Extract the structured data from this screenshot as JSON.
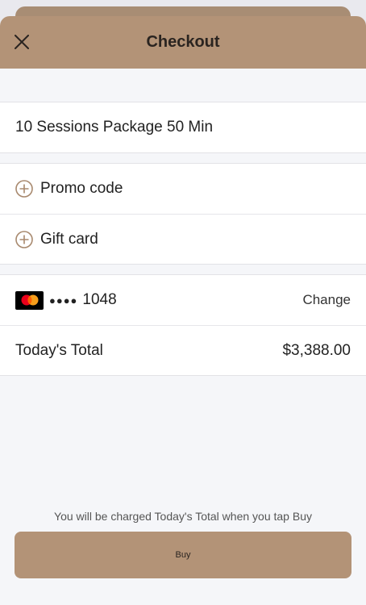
{
  "header": {
    "title": "Checkout",
    "close_icon": "close-icon"
  },
  "product": {
    "name": "10 Sessions Package 50 Min"
  },
  "discounts": {
    "promo_label": "Promo code",
    "gift_label": "Gift card",
    "icon": "plus-circle-icon"
  },
  "payment": {
    "card_brand_icon": "mastercard-icon",
    "masked_dots": "●●●●",
    "last4": "1048",
    "change_label": "Change"
  },
  "total": {
    "label": "Today's Total",
    "amount": "$3,388.00"
  },
  "footer": {
    "note": "You will be charged Today's Total when you tap Buy",
    "buy_label": "Buy"
  },
  "colors": {
    "brand": "#b39377",
    "icon_accent": "#a8896e",
    "background": "#f5f6f9"
  }
}
